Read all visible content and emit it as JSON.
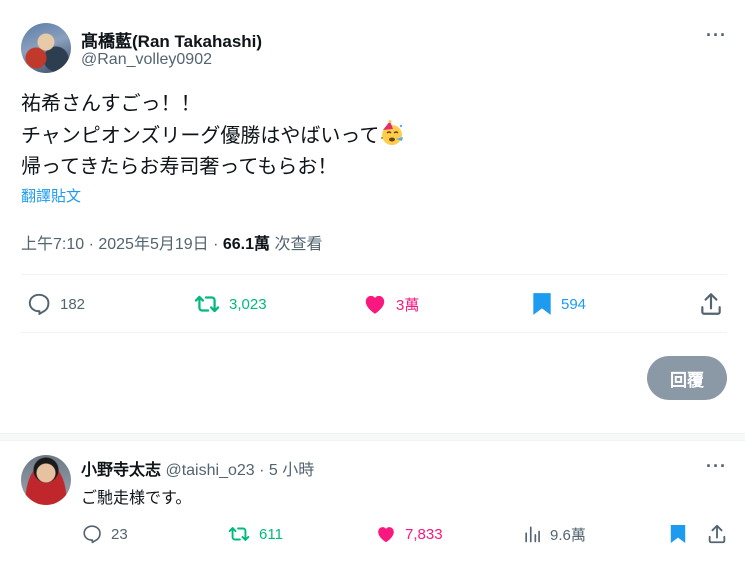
{
  "tweet": {
    "display_name": "髙橋藍(Ran Takahashi)",
    "handle": "@Ran_volley0902",
    "lines": [
      "祐希さんすごっ！！",
      "チャンピオンズリーグ優勝はやばいって",
      "帰ってきたらお寿司奢ってもらお！"
    ],
    "emoji": "partying-face",
    "translate_label": "翻譯貼文",
    "timestamp": "上午7:10 · 2025年5月19日 · ",
    "views_count": "66.1萬",
    "views_label": " 次查看",
    "stats": {
      "replies": "182",
      "retweets": "3,023",
      "likes": "3萬",
      "bookmarks": "594"
    },
    "colors": {
      "retweet": "#00ba7c",
      "like": "#f91880",
      "bookmark": "#1d9bf0"
    }
  },
  "reply_button": {
    "label": "回覆"
  },
  "reply": {
    "display_name": "小野寺太志",
    "handle": "@taishi_o23",
    "time": " · 5 小時",
    "text": "ご馳走様です。",
    "stats": {
      "replies": "23",
      "retweets": "611",
      "likes": "7,833",
      "views": "9.6萬"
    }
  },
  "more_label": "···"
}
